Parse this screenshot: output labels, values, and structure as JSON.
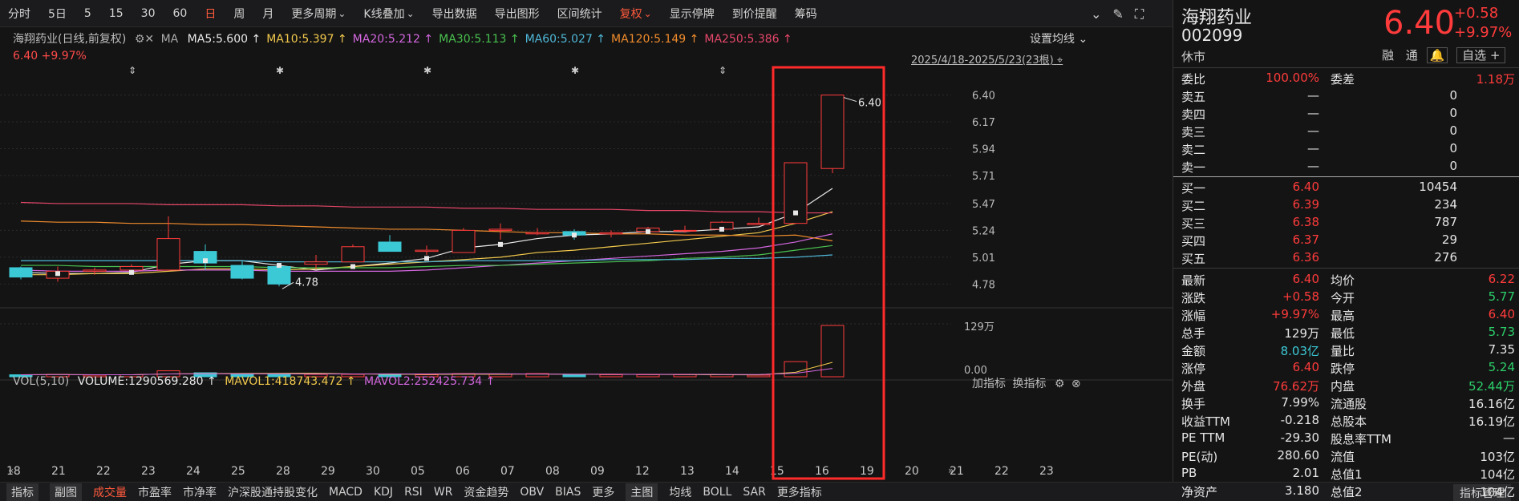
{
  "toolbar": {
    "items": [
      "分时",
      "5日",
      "5",
      "15",
      "30",
      "60",
      "日",
      "周",
      "月",
      "更多周期",
      "K线叠加",
      "导出数据",
      "导出图形",
      "区间统计",
      "复权",
      "显示停牌",
      "到价提醒",
      "筹码"
    ],
    "active_index": 6,
    "highlight_index": 14
  },
  "chart": {
    "title_line": "海翔药业(日线,前复权)",
    "ma_label": "MA",
    "ma_values": [
      {
        "text": "MA5:5.600 ↑",
        "color": "#e8e8e8"
      },
      {
        "text": "MA10:5.397 ↑",
        "color": "#f2c94c"
      },
      {
        "text": "MA20:5.212 ↑",
        "color": "#d467e0"
      },
      {
        "text": "MA30:5.113 ↑",
        "color": "#49c14f"
      },
      {
        "text": "MA60:5.027 ↑",
        "color": "#4fb8d8"
      },
      {
        "text": "MA120:5.149 ↑",
        "color": "#ef8b2c"
      },
      {
        "text": "MA250:5.386 ↑",
        "color": "#e6476a"
      }
    ],
    "ma_settings": "设置均线",
    "price_change": "6.40 +9.97%",
    "date_range": "2025/4/18-2025/5/23(23根)",
    "high_label": "6.40",
    "low_label": "4.78",
    "price_axis": [
      "6.40",
      "6.17",
      "5.94",
      "5.71",
      "5.47",
      "5.24",
      "5.01",
      "4.78"
    ],
    "vol_line": "VOL(5,10)",
    "volume_text": "VOLUME:1290569.280 ↑",
    "mavol1": "MAVOL1:418743.472 ↑",
    "mavol2": "MAVOL2:252425.734 ↑",
    "vol_buttons": [
      "加指标",
      "换指标"
    ],
    "vol_axis": [
      "129万",
      "0.00"
    ],
    "dates": [
      "18",
      "21",
      "22",
      "23",
      "24",
      "25",
      "28",
      "29",
      "30",
      "05",
      "06",
      "07",
      "08",
      "09",
      "12",
      "13",
      "14",
      "15",
      "16",
      "19",
      "20",
      "21",
      "22",
      "23"
    ]
  },
  "chart_data": {
    "type": "candlestick",
    "categories": [
      "04-18",
      "04-21",
      "04-22",
      "04-23",
      "04-24",
      "04-25",
      "04-28",
      "04-29",
      "04-30",
      "05-06",
      "05-07",
      "05-08",
      "05-09",
      "05-12",
      "05-13",
      "05-14",
      "05-15",
      "05-16",
      "05-19",
      "05-20",
      "05-21",
      "05-22",
      "05-23"
    ],
    "ohlc": [
      [
        4.92,
        4.93,
        4.82,
        4.84
      ],
      [
        4.83,
        4.93,
        4.8,
        4.89
      ],
      [
        4.89,
        4.92,
        4.86,
        4.9
      ],
      [
        4.9,
        4.95,
        4.88,
        4.93
      ],
      [
        4.9,
        5.36,
        4.9,
        5.17
      ],
      [
        5.06,
        5.12,
        4.9,
        4.96
      ],
      [
        4.94,
        4.98,
        4.82,
        4.83
      ],
      [
        4.93,
        4.93,
        4.76,
        4.78
      ],
      [
        4.95,
        5.03,
        4.91,
        4.97
      ],
      [
        4.97,
        5.12,
        4.97,
        5.1
      ],
      [
        5.14,
        5.2,
        5.06,
        5.06
      ],
      [
        5.06,
        5.11,
        5.03,
        5.07
      ],
      [
        5.05,
        5.26,
        5.05,
        5.24
      ],
      [
        5.24,
        5.3,
        5.16,
        5.25
      ],
      [
        5.21,
        5.26,
        5.2,
        5.22
      ],
      [
        5.23,
        5.25,
        5.16,
        5.2
      ],
      [
        5.21,
        5.24,
        5.18,
        5.22
      ],
      [
        5.23,
        5.27,
        5.22,
        5.26
      ],
      [
        5.24,
        5.28,
        5.22,
        5.24
      ],
      [
        5.25,
        5.32,
        5.25,
        5.31
      ],
      [
        5.29,
        5.35,
        5.29,
        5.3
      ],
      [
        5.3,
        5.82,
        5.3,
        5.82
      ],
      [
        5.77,
        6.4,
        5.73,
        6.4
      ]
    ],
    "volume_wan": [
      5,
      6,
      4,
      5,
      15,
      10,
      7,
      6,
      6,
      6,
      7,
      5,
      8,
      6,
      8,
      5,
      5,
      5,
      5,
      5,
      4,
      38,
      129
    ],
    "ylim": [
      4.7,
      6.5
    ],
    "vol_max_wan": 129,
    "ma_series": [
      {
        "name": "MA5",
        "color": "#e8e8e8",
        "values": [
          4.88,
          4.87,
          4.87,
          4.88,
          4.95,
          4.98,
          4.98,
          4.94,
          4.9,
          4.93,
          4.96,
          5.0,
          5.09,
          5.12,
          5.17,
          5.2,
          5.21,
          5.23,
          5.23,
          5.25,
          5.27,
          5.39,
          5.6
        ]
      },
      {
        "name": "MA10",
        "color": "#f2c94c",
        "values": [
          4.86,
          4.86,
          4.87,
          4.87,
          4.89,
          4.91,
          4.91,
          4.9,
          4.91,
          4.93,
          4.95,
          4.97,
          4.99,
          5.01,
          5.05,
          5.07,
          5.1,
          5.13,
          5.16,
          5.19,
          5.22,
          5.3,
          5.4
        ]
      },
      {
        "name": "MA20",
        "color": "#d467e0",
        "values": [
          4.9,
          4.89,
          4.89,
          4.89,
          4.9,
          4.9,
          4.9,
          4.89,
          4.89,
          4.89,
          4.89,
          4.9,
          4.92,
          4.94,
          4.96,
          4.98,
          5.0,
          5.02,
          5.04,
          5.06,
          5.09,
          5.14,
          5.21
        ]
      },
      {
        "name": "MA30",
        "color": "#49c14f",
        "values": [
          4.94,
          4.94,
          4.93,
          4.93,
          4.93,
          4.93,
          4.93,
          4.92,
          4.92,
          4.92,
          4.92,
          4.93,
          4.94,
          4.94,
          4.95,
          4.96,
          4.97,
          4.98,
          5.0,
          5.01,
          5.03,
          5.07,
          5.11
        ]
      },
      {
        "name": "MA60",
        "color": "#4fb8d8",
        "values": [
          4.98,
          4.98,
          4.98,
          4.98,
          4.98,
          4.98,
          4.98,
          4.97,
          4.97,
          4.97,
          4.97,
          4.97,
          4.98,
          4.98,
          4.98,
          4.98,
          4.99,
          4.99,
          4.99,
          5.0,
          5.0,
          5.01,
          5.03
        ]
      },
      {
        "name": "MA120",
        "color": "#ef8b2c",
        "values": [
          5.32,
          5.31,
          5.31,
          5.3,
          5.3,
          5.29,
          5.29,
          5.28,
          5.27,
          5.26,
          5.25,
          5.25,
          5.24,
          5.23,
          5.22,
          5.22,
          5.21,
          5.21,
          5.2,
          5.2,
          5.19,
          5.2,
          5.15
        ]
      },
      {
        "name": "MA250",
        "color": "#e6476a",
        "values": [
          5.48,
          5.47,
          5.47,
          5.47,
          5.46,
          5.46,
          5.46,
          5.45,
          5.45,
          5.44,
          5.44,
          5.44,
          5.43,
          5.43,
          5.42,
          5.42,
          5.42,
          5.41,
          5.41,
          5.4,
          5.4,
          5.39,
          5.39
        ]
      }
    ]
  },
  "panel": {
    "name": "海翔药业",
    "code": "002099",
    "status": "休市",
    "price": "6.40",
    "change": "+0.58",
    "change_pct": "+9.97%",
    "tags": [
      "融",
      "通"
    ],
    "watch_label": "自选",
    "weibi_label": "委比",
    "weibi": "100.00%",
    "weicha_label": "委差",
    "weicha": "1.18万",
    "asks": [
      {
        "label": "卖五",
        "price": "—",
        "vol": "0"
      },
      {
        "label": "卖四",
        "price": "—",
        "vol": "0"
      },
      {
        "label": "卖三",
        "price": "—",
        "vol": "0"
      },
      {
        "label": "卖二",
        "price": "—",
        "vol": "0"
      },
      {
        "label": "卖一",
        "price": "—",
        "vol": "0"
      }
    ],
    "bids": [
      {
        "label": "买一",
        "price": "6.40",
        "vol": "10454"
      },
      {
        "label": "买二",
        "price": "6.39",
        "vol": "234"
      },
      {
        "label": "买三",
        "price": "6.38",
        "vol": "787"
      },
      {
        "label": "买四",
        "price": "6.37",
        "vol": "29"
      },
      {
        "label": "买五",
        "price": "6.36",
        "vol": "276"
      }
    ],
    "stats": [
      {
        "l1": "最新",
        "v1": "6.40",
        "c1": "red",
        "l2": "均价",
        "v2": "6.22",
        "c2": "red"
      },
      {
        "l1": "涨跌",
        "v1": "+0.58",
        "c1": "red",
        "l2": "今开",
        "v2": "5.77",
        "c2": "green"
      },
      {
        "l1": "涨幅",
        "v1": "+9.97%",
        "c1": "red",
        "l2": "最高",
        "v2": "6.40",
        "c2": "red"
      },
      {
        "l1": "总手",
        "v1": "129万",
        "c1": "white",
        "l2": "最低",
        "v2": "5.73",
        "c2": "green"
      },
      {
        "l1": "金额",
        "v1": "8.03亿",
        "c1": "cyan",
        "l2": "量比",
        "v2": "7.35",
        "c2": "white"
      },
      {
        "l1": "涨停",
        "v1": "6.40",
        "c1": "red",
        "l2": "跌停",
        "v2": "5.24",
        "c2": "green"
      },
      {
        "l1": "外盘",
        "v1": "76.62万",
        "c1": "red",
        "l2": "内盘",
        "v2": "52.44万",
        "c2": "green"
      },
      {
        "l1": "换手",
        "v1": "7.99%",
        "c1": "white",
        "l2": "流通股",
        "v2": "16.16亿",
        "c2": "white"
      },
      {
        "l1": "收益TTM",
        "v1": "-0.218",
        "c1": "white",
        "l2": "总股本",
        "v2": "16.19亿",
        "c2": "white"
      },
      {
        "l1": "PE TTM",
        "v1": "-29.30",
        "c1": "white",
        "l2": "股息率TTM",
        "v2": "—",
        "c2": "white"
      },
      {
        "l1": "PE(动)",
        "v1": "280.60",
        "c1": "white",
        "l2": "流值",
        "v2": "103亿",
        "c2": "white"
      },
      {
        "l1": "PB",
        "v1": "2.01",
        "c1": "white",
        "l2": "总值1",
        "v2": "104亿",
        "c2": "white"
      },
      {
        "l1": "净资产",
        "v1": "3.180",
        "c1": "white",
        "l2": "总值2",
        "v2": "104亿",
        "c2": "white"
      }
    ]
  },
  "bottom_tabs": [
    "指标",
    "副图",
    "成交量",
    "市盈率",
    "市净率",
    "沪深股通持股变化",
    "MACD",
    "KDJ",
    "RSI",
    "WR",
    "资金趋势",
    "OBV",
    "BIAS",
    "更多",
    "主图",
    "均线",
    "BOLL",
    "SAR",
    "更多指标"
  ],
  "bottom_right": "指标管理",
  "colors": {
    "up": "#ff3b3b",
    "down": "#3cc9d6",
    "highlight_box": "#ff2a2a"
  }
}
